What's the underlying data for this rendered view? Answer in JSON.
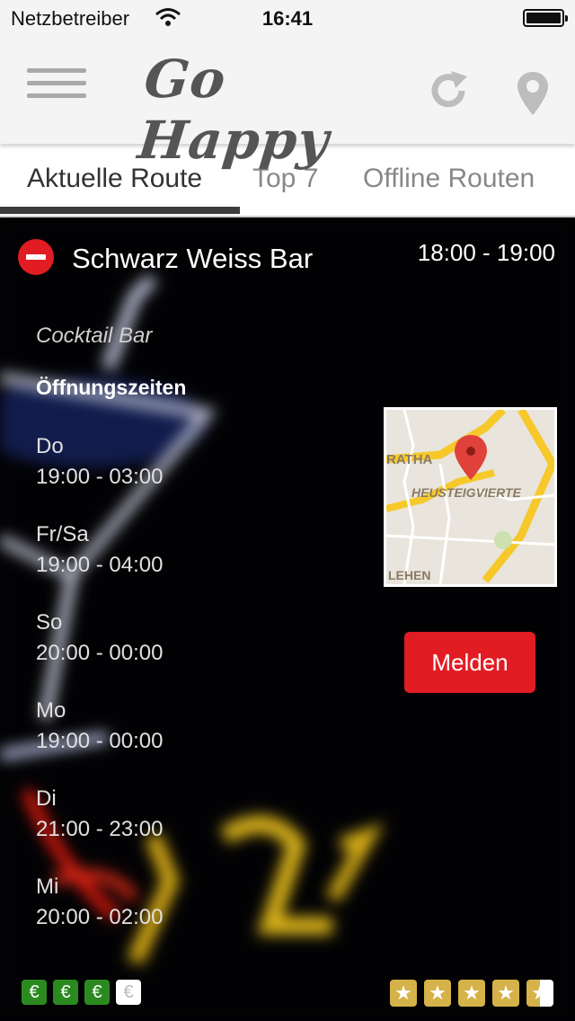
{
  "status_bar": {
    "carrier": "Netzbetreiber",
    "time": "16:41"
  },
  "header": {
    "app_title": "Go Happy"
  },
  "tabs": [
    {
      "label": "Aktuelle Route",
      "active": true
    },
    {
      "label": "Top 7",
      "active": false
    },
    {
      "label": "Offline Routen",
      "active": false
    }
  ],
  "venue": {
    "name": "Schwarz Weiss Bar",
    "time_range": "18:00 - 19:00",
    "category": "Cocktail Bar",
    "hours_title": "Öffnungszeiten",
    "hours": [
      {
        "day": "Do",
        "range": "19:00 - 03:00"
      },
      {
        "day": "Fr/Sa",
        "range": "19:00 - 04:00"
      },
      {
        "day": "So",
        "range": "20:00 - 00:00"
      },
      {
        "day": "Mo",
        "range": "19:00 - 00:00"
      },
      {
        "day": "Di",
        "range": "21:00 - 23:00"
      },
      {
        "day": "Mi",
        "range": "20:00 - 02:00"
      }
    ],
    "map_labels": [
      "RATHA",
      "HEUSTEIGVIERTE",
      "LEHEN"
    ],
    "report_button": "Melden",
    "price_level": 3,
    "price_max": 4,
    "price_symbol": "€",
    "rating": 4.5,
    "rating_max": 5,
    "star_symbol": "★"
  },
  "colors": {
    "accent_red": "#e21c23",
    "price_green": "#2b8a1f",
    "star_gold": "#d5b24a",
    "header_bg": "#f4f4f4"
  }
}
